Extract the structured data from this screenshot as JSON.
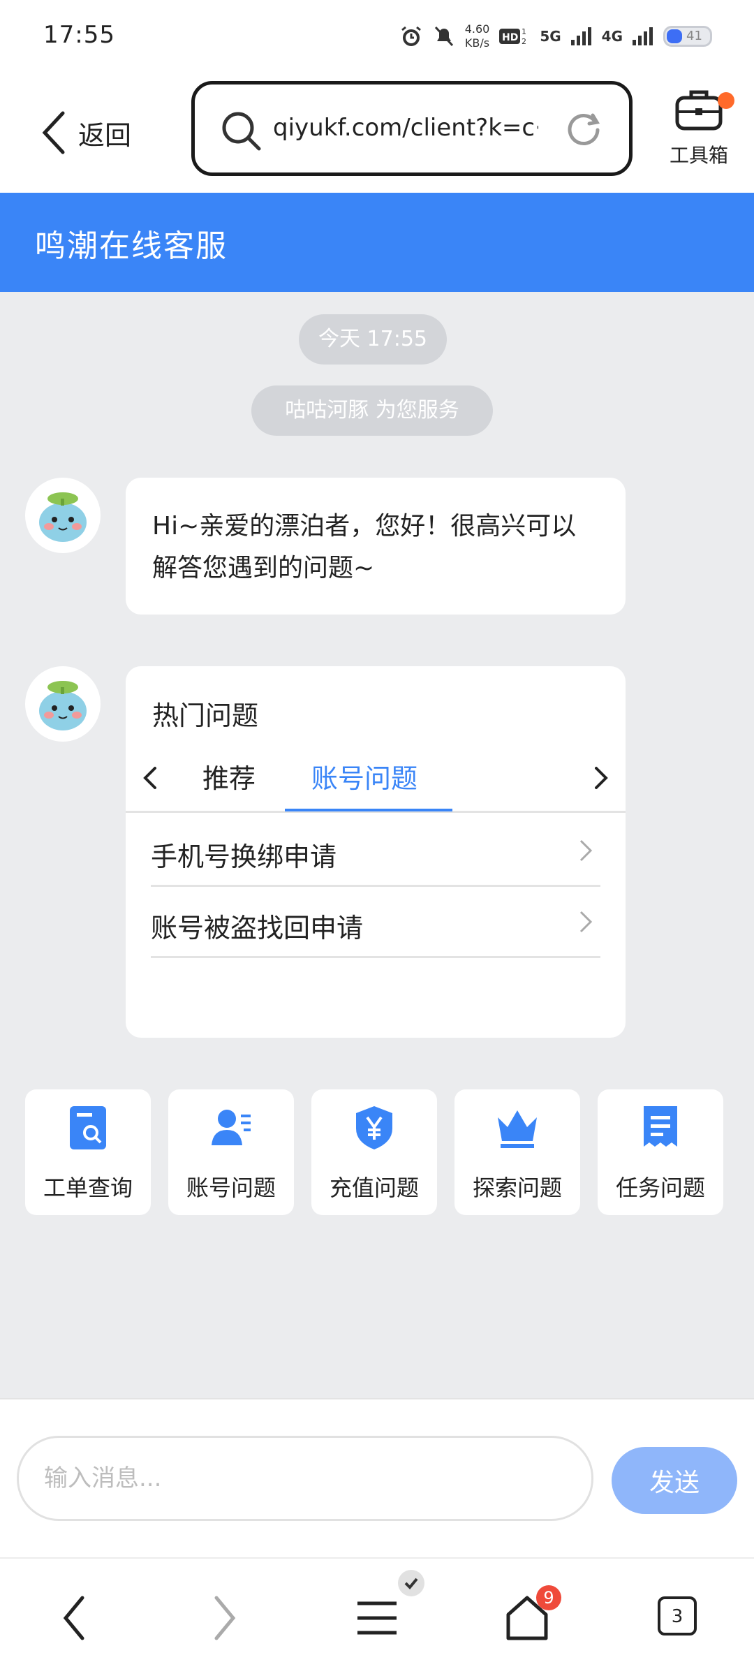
{
  "status_bar": {
    "time": "17:55",
    "net_speed_value": "4.60",
    "net_speed_unit": "KB/s",
    "signal_1": "5G",
    "signal_2": "4G",
    "battery": "41"
  },
  "browser": {
    "back_label": "返回",
    "url": "qiyukf.com/client?k=c···",
    "toolbox_label": "工具箱"
  },
  "chat": {
    "title": "鸣潮在线客服",
    "time_pill": "今天 17:55",
    "service_pill": "咕咕河豚 为您服务",
    "greeting": "Hi~亲爱的漂泊者，您好！很高兴可以解答您遇到的问题~",
    "hot_title": "热门问题",
    "tabs": [
      "推荐",
      "账号问题"
    ],
    "faqs": [
      "手机号换绑申请",
      "账号被盗找回申请"
    ]
  },
  "tiles": [
    {
      "label": "工单查询",
      "icon": "ticket-search-icon"
    },
    {
      "label": "账号问题",
      "icon": "user-list-icon"
    },
    {
      "label": "充值问题",
      "icon": "yen-shield-icon"
    },
    {
      "label": "探索问题",
      "icon": "crown-icon"
    },
    {
      "label": "任务问题",
      "icon": "task-doc-icon"
    }
  ],
  "input": {
    "placeholder": "输入消息...",
    "send_label": "发送"
  },
  "nav": {
    "badge_home": "9",
    "tabs_count": "3"
  },
  "colors": {
    "accent": "#3a85f7",
    "send_disabled": "#8fb6fa",
    "background": "#ebecee",
    "badge": "#ef4a3a",
    "toolbox_dot": "#ff6a2a"
  }
}
